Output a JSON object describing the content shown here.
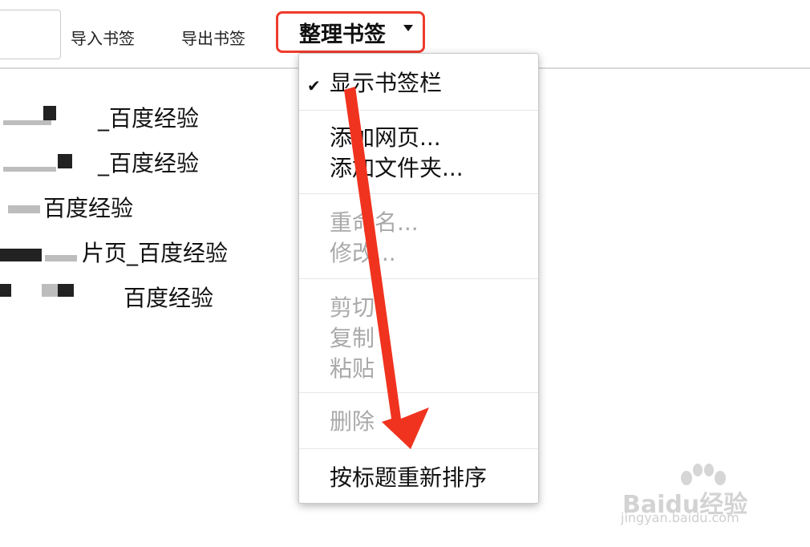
{
  "toolbar": {
    "import_label": "导入书签",
    "export_label": "导出书签",
    "organize_label": "整理书签"
  },
  "bookmarks": [
    {
      "label": "_百度经验"
    },
    {
      "label": "_百度经验"
    },
    {
      "label": "百度经验"
    },
    {
      "label": "片页_百度经验"
    },
    {
      "label": "百度经验"
    }
  ],
  "menu": {
    "items": [
      {
        "label": "显示书签栏",
        "checked": true,
        "enabled": true
      },
      {
        "label": "添加网页...",
        "enabled": true
      },
      {
        "label": "添加文件夹...",
        "enabled": true
      },
      {
        "label": "重命名...",
        "enabled": false
      },
      {
        "label": "修改...",
        "enabled": false
      },
      {
        "label": "剪切",
        "enabled": false
      },
      {
        "label": "复制",
        "enabled": false
      },
      {
        "label": "粘贴",
        "enabled": false
      },
      {
        "label": "删除",
        "enabled": false
      },
      {
        "label": "按标题重新排序",
        "enabled": true
      }
    ]
  },
  "icons": {
    "check": "checkmark-icon",
    "caret": "caret-down-icon"
  },
  "colors": {
    "highlight": "#ef3b2c",
    "arrow": "#f0331f",
    "disabled_text": "#a9a9a9"
  },
  "watermark": {
    "brand": "Baidu经验",
    "url": "jingyan.baidu.com"
  }
}
